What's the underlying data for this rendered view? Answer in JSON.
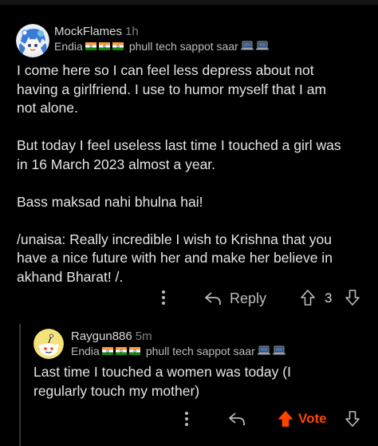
{
  "comment1": {
    "username": "MockFlames",
    "time": "1h",
    "flair_prefix": "Endia",
    "flair_text": "phull tech sappot saar",
    "paragraphs": [
      [
        "I come here so I can feel less depress about not",
        "having a girlfriend. I use to humor myself that I am",
        "not alone."
      ],
      [
        "But today I feel useless last time I touched a girl was",
        "in 16 March 2023 almost a year."
      ],
      [
        "Bass maksad nahi bhulna hai!"
      ],
      [
        "/unaisa: Really incredible I wish to Krishna that you",
        "have a nice future with her and make her believe in",
        "akhand Bharat!  /."
      ]
    ],
    "reply_label": "Reply",
    "score": "3"
  },
  "comment2": {
    "username": "Raygun886",
    "time": "5m",
    "flair_prefix": "Endia",
    "flair_text": "phull tech sappot saar",
    "lines": [
      "Last time I touched a women was today (I",
      "regularly touch my mother)"
    ],
    "vote_label": "Vote"
  },
  "icons": {
    "more": "more-vertical-icon",
    "reply": "reply-arrow-icon",
    "upvote": "upvote-arrow-icon",
    "downvote": "downvote-arrow-icon",
    "flag": "india-flag-icon",
    "laptop": "laptop-icon"
  },
  "colors": {
    "background": "#000000",
    "text": "#e3e5e7",
    "muted": "#818384",
    "upvote_active": "#ff4500",
    "thread_line": "#343536"
  }
}
